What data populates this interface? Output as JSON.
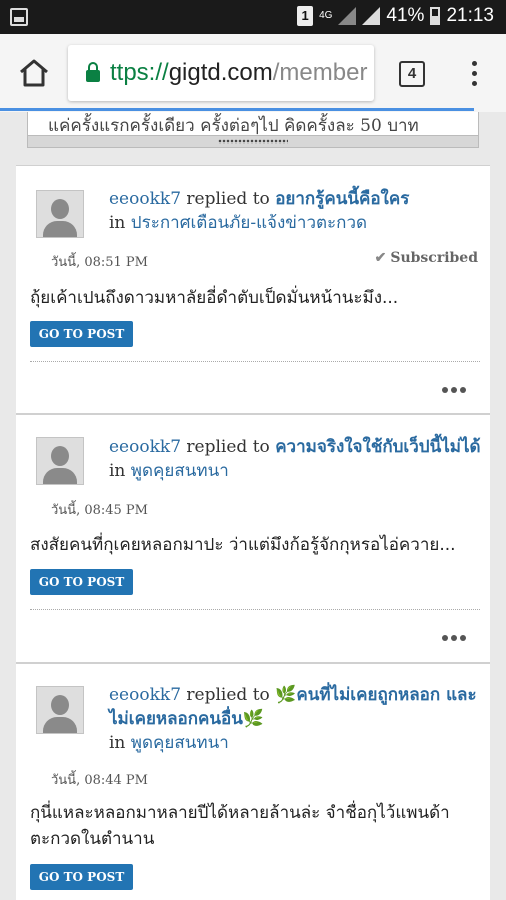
{
  "status": {
    "sim": "1",
    "network": "4G",
    "battery": "41%",
    "clock": "21:13"
  },
  "browser": {
    "url_scheme": "ttps://",
    "url_host": "gigtd.com",
    "url_path": "/member",
    "tab_count": "4"
  },
  "signature": {
    "text": "แค่ครั้งแรกครั้งเดียว ครั้งต่อๆไป คิดครั้งละ 50 บาท"
  },
  "posts": [
    {
      "user": "eeookk7",
      "action": " replied to ",
      "title": "อยากรู้คนนี้คือใคร",
      "in": "in ",
      "forum": "ประกาศเตือนภัย-แจ้งข่าวตะกวด",
      "time": "วันนี้, 08:51 PM",
      "subscribed": "Subscribed",
      "snippet": "ถุ้ยเค้าเปนถึงดาวมหาลัยอี่ดำตับเป็ดมั่นหน้านะมึง...",
      "button": "GO TO POST"
    },
    {
      "user": "eeookk7",
      "action": " replied to ",
      "title": "ความจริงใจใช้กับเว็ปนี้ไม่ได้",
      "in": "in ",
      "forum": "พูดคุยสนทนา",
      "time": "วันนี้, 08:45 PM",
      "snippet": "สงสัยคนที่กุเคยหลอกมาปะ ว่าแต่มึงก้อรู้จักกุหรอไอ่ควาย...",
      "button": "GO TO POST"
    },
    {
      "user": "eeookk7",
      "action": " replied to ",
      "title": "🌿คนที่ไม่เคยถูกหลอก และไม่เคยหลอกคนอื่น🌿",
      "in": "in ",
      "forum": "พูดคุยสนทนา",
      "time": "วันนี้, 08:44 PM",
      "snippet": "กุนี่แหละหลอกมาหลายปีได้หลายล้านล่ะ จำชื่อกุไว้แพนด้า ตะกวดในตำนาน",
      "button": "GO TO POST"
    }
  ]
}
